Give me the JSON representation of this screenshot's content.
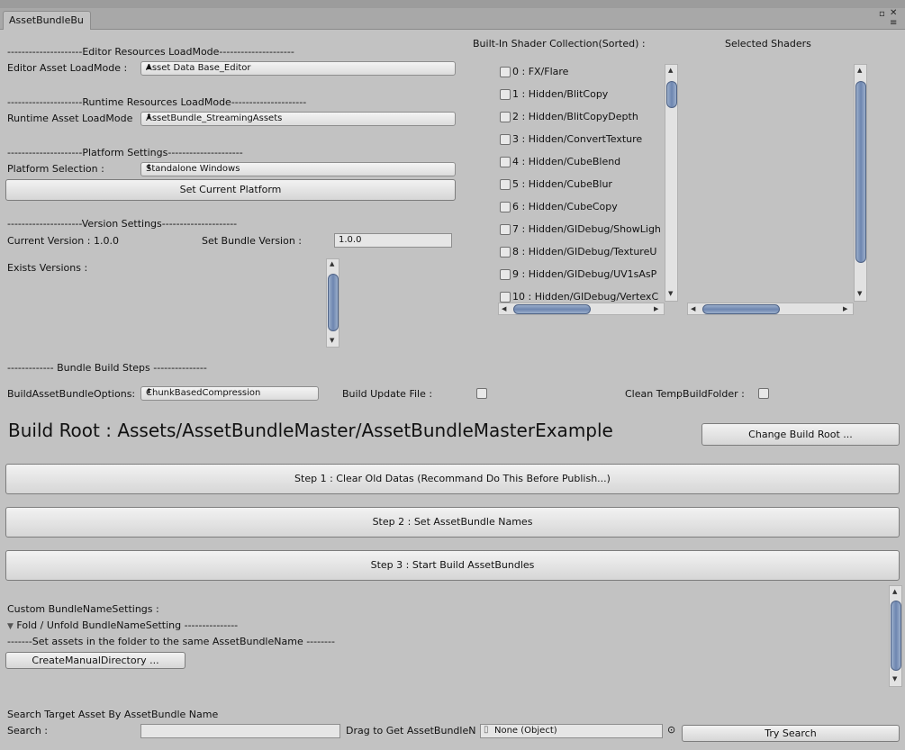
{
  "window": {
    "tab_title": "AssetBundleBu",
    "controls": {
      "maximize": "▫",
      "close": "✕",
      "menu": "≡"
    }
  },
  "editor_loadmode": {
    "header": "---------------------Editor Resources LoadMode---------------------",
    "label": "Editor Asset LoadMode :",
    "value": "Asset Data Base_Editor"
  },
  "runtime_loadmode": {
    "header": "---------------------Runtime Resources LoadMode---------------------",
    "label": "Runtime Asset LoadMode",
    "value": "AssetBundle_StreamingAssets"
  },
  "platform": {
    "header": "---------------------Platform Settings---------------------",
    "label": "Platform Selection :",
    "value": "Standalone Windows",
    "set_button": "Set Current Platform"
  },
  "version": {
    "header": "---------------------Version Settings---------------------",
    "current_label": "Current Version : 1.0.0",
    "set_label": "Set Bundle Version :",
    "set_value": "1.0.0",
    "exists_label": "Exists Versions :"
  },
  "shaders": {
    "builtin_title": "Built-In Shader Collection(Sorted) :",
    "selected_title": "Selected Shaders",
    "items": [
      "0 : FX/Flare",
      "1 : Hidden/BlitCopy",
      "2 : Hidden/BlitCopyDepth",
      "3 : Hidden/ConvertTexture",
      "4 : Hidden/CubeBlend",
      "5 : Hidden/CubeBlur",
      "6 : Hidden/CubeCopy",
      "7 : Hidden/GIDebug/ShowLigh",
      "8 : Hidden/GIDebug/TextureU",
      "9 : Hidden/GIDebug/UV1sAsP",
      "10 : Hidden/GIDebug/VertexC"
    ]
  },
  "build_steps": {
    "header": "------------- Bundle Build Steps ---------------",
    "options_label": "BuildAssetBundleOptions:",
    "options_value": "ChunkBasedCompression",
    "update_label": "Build Update File :",
    "clean_label": "Clean TempBuildFolder :"
  },
  "build_root": {
    "text": "Build Root : Assets/AssetBundleMaster/AssetBundleMasterExample",
    "change_button": "Change Build Root ..."
  },
  "steps": {
    "step1": "Step 1 : Clear Old Datas (Recommand Do This Before Publish...)",
    "step2": "Step 2 : Set AssetBundle Names",
    "step3": "Step 3 : Start Build AssetBundles"
  },
  "custom": {
    "title": "Custom BundleNameSettings :",
    "fold_label": "Fold / Unfold BundleNameSetting ---------------",
    "folder_note": "-------Set assets in the folder to the same AssetBundleName --------",
    "create_button": "CreateManualDirectory ..."
  },
  "search": {
    "title": "Search Target Asset By AssetBundle Name",
    "label": "Search :",
    "value": "",
    "drag_label": "Drag to Get AssetBundleN",
    "object_value": "None (Object)",
    "try_button": "Try Search"
  }
}
